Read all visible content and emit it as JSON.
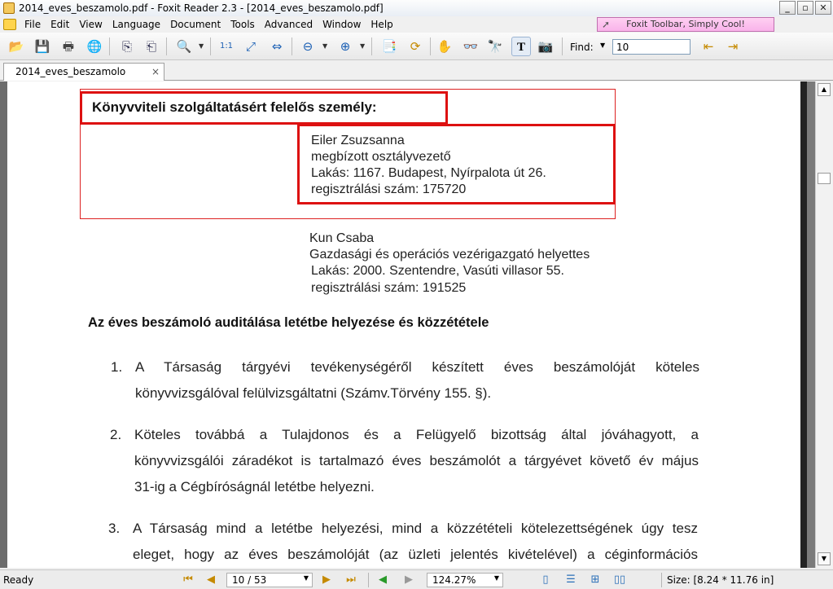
{
  "window": {
    "title": "2014_eves_beszamolo.pdf - Foxit Reader 2.3 - [2014_eves_beszamolo.pdf]",
    "minimize": "_",
    "maximize": "▫",
    "close": "✕"
  },
  "menu": {
    "items": [
      "File",
      "Edit",
      "View",
      "Language",
      "Document",
      "Tools",
      "Advanced",
      "Window",
      "Help"
    ],
    "promo": "Foxit Toolbar, Simply Cool!"
  },
  "toolbar": {
    "find_label": "Find:",
    "find_value": "10"
  },
  "tab": {
    "label": "2014_eves_beszamolo",
    "close": "×"
  },
  "document": {
    "heading": "Könyvviteli szolgáltatásért felelős személy:",
    "contact1": [
      "Eiler Zsuzsanna",
      "megbízott osztályvezető",
      "Lakás: 1167. Budapest, Nyírpalota út 26.",
      "regisztrálási szám: 175720"
    ],
    "contact2": [
      "Kun Csaba",
      "Gazdasági és operációs vezérigazgató helyettes",
      "Lakás: 2000. Szentendre, Vasúti villasor 55.",
      "regisztrálási szám: 191525"
    ],
    "section_title": "Az éves beszámoló auditálása letétbe helyezése és közzététele",
    "items": [
      {
        "num": "1.",
        "line1": "A Társaság tárgyévi tevékenységéről készített éves beszámolóját köteles",
        "line2": "könyvvizsgálóval felülvizsgáltatni (Számv.Törvény 155. §)."
      },
      {
        "num": "2.",
        "line1": "Köteles továbbá a Tulajdonos és a Felügyelő bizottság által jóváhagyott, a",
        "line2": "könyvvizsgálói záradékot is tartalmazó éves beszámolót a tárgyévet követő év május",
        "line3": "31-ig a Cégbíróságnál letétbe helyezni."
      },
      {
        "num": "3.",
        "line1": "A Társaság mind a letétbe helyezési, mind a közzétételi kötelezettségének úgy tesz",
        "line2": "eleget, hogy az éves beszámolóját (az üzleti jelentés kivételével) a céginformációs"
      }
    ]
  },
  "status": {
    "ready": "Ready",
    "page": "10 / 53",
    "zoom": "124.27%",
    "size": "Size: [8.24 * 11.76 in]"
  }
}
